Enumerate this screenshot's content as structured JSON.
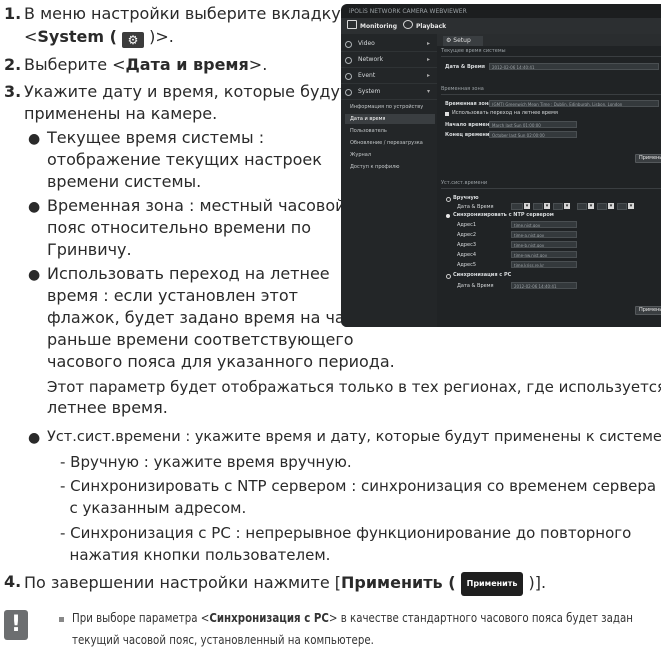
{
  "instructions": {
    "step1_num": "1.",
    "step1_text": "В меню настройки выберите вкладку",
    "step1_line2_pre": "<",
    "step1_line2_bold": "System (",
    "step1_line2_post": ")>.",
    "step2_num": "2.",
    "step2_pre": "Выберите <",
    "step2_bold": "Дата и время",
    "step2_post": ">.",
    "step3_num": "3.",
    "step3_lines": [
      "Укажите дату и время, которые будут",
      "применены на камере."
    ],
    "bullet1_lines": [
      "Текущее время системы :",
      "отображение текущих настроек",
      "времени системы."
    ],
    "bullet2_lines": [
      "Временная зона : местный часовой",
      "пояс относительно времени по",
      "Гринвичу."
    ],
    "bullet3_lines": [
      "Использовать переход на летнее",
      "время : если установлен этот",
      "флажок, будет задано время на час",
      "раньше времени соответствующего",
      "часового пояса для указанного периода."
    ],
    "bullet3_extra_lines": [
      "Этот параметр будет отображаться только в тех регионах, где используется",
      "летнее время."
    ],
    "bullet4": "Уст.сист.времени : укажите время и дату, которые будут применены к системе.",
    "sub_items": [
      {
        "lines": [
          "- Вручную : укажите время вручную."
        ]
      },
      {
        "lines": [
          "- Синхронизировать с NTP сервером : синхронизация со временем сервера",
          "  с указанным адресом."
        ]
      },
      {
        "lines": [
          "- Синхронизация с PC : непрерывное функционирование до повторного",
          "  нажатия кнопки пользователем."
        ]
      }
    ],
    "step4_num": "4.",
    "step4_pre": "По завершении настройки нажмите [",
    "step4_bold": "Применить (",
    "step4_btn": "Применить",
    "step4_post": ")]."
  },
  "note": {
    "icon": "!",
    "line1_pre": "При выборе параметра <",
    "line1_bold": "Синхронизация с PC",
    "line1_post": "> в качестве стандартного часового пояса будет задан",
    "line2": "текущий часовой пояс, установленный на компьютере."
  },
  "camera_ui": {
    "brand": "iPOLiS NETWORK CAMERA WEBVIEWER",
    "tabs": [
      "Monitoring",
      "Playback"
    ],
    "setup_tab": "Setup",
    "menus": [
      "Video",
      "Network",
      "Event",
      "System"
    ],
    "submenu": [
      "Информация по устройству",
      "Дата и время",
      "Пользователь",
      "Обновление / перезагрузка",
      "Журнал",
      "Доступ к профилю"
    ],
    "sect_current": "Текущее время системы",
    "label_datetime": "Дата & Время",
    "value_datetime": "2012-02-06 14:40:41",
    "sect_zone": "Временная зона",
    "label_zone": "Временная зона",
    "value_zone": "(GMT) Greenwich Mean Time : Dublin, Edinburgh, Lisbon, London",
    "dst_check": "Использовать переход на летнее время",
    "label_start": "Начало времени",
    "value_start": "March last Sun 01:00:00",
    "label_end": "Конец времени",
    "value_end": "October last Sun 02:00:00",
    "apply": "Применить",
    "sect_sys": "Уст.сист.времени",
    "opt_manual": "Вручную",
    "label_dt2": "Дата & Время",
    "opt_ntp": "Синхронизировать с NTP сервером",
    "addr_labels": [
      "Адрес1",
      "Адрес2",
      "Адрес3",
      "Адрес4",
      "Адрес5"
    ],
    "addr_values": [
      "time.nist.gov",
      "time-a.nist.gov",
      "time-b.nist.gov",
      "time-nw.nist.gov",
      "time.kriss.re.kr"
    ],
    "opt_pc": "Синхронизация с PC",
    "label_dt3": "Дата & Время",
    "value_dt3": "2012-02-06 14:40:41"
  }
}
